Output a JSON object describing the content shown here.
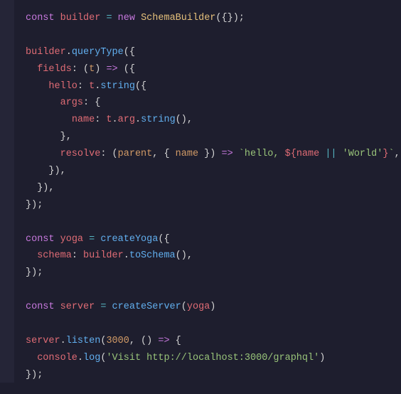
{
  "code": {
    "l1_const": "const",
    "l1_builder": "builder",
    "l1_eq": " = ",
    "l1_new": "new",
    "l1_class": "SchemaBuilder",
    "l1_rest": "({});",
    "l3_builder": "builder",
    "l3_dot": ".",
    "l3_method": "queryType",
    "l3_rest": "({",
    "l4_prop": "fields",
    "l4_colon": ": (",
    "l4_param": "t",
    "l4_rest1": ") ",
    "l4_arrow": "=>",
    "l4_rest2": " ({",
    "l5_prop": "hello",
    "l5_colon": ": ",
    "l5_t": "t",
    "l5_dot": ".",
    "l5_method": "string",
    "l5_rest": "({",
    "l6_prop": "args",
    "l6_rest": ": {",
    "l7_prop": "name",
    "l7_colon": ": ",
    "l7_t": "t",
    "l7_dot1": ".",
    "l7_arg": "arg",
    "l7_dot2": ".",
    "l7_method": "string",
    "l7_rest": "(),",
    "l8": "},",
    "l9_prop": "resolve",
    "l9_colon": ": (",
    "l9_parent": "parent",
    "l9_comma": ", { ",
    "l9_name": "name",
    "l9_close": " }) ",
    "l9_arrow": "=>",
    "l9_space": " ",
    "l9_tick1": "`",
    "l9_str1": "hello, ",
    "l9_interp_open": "${",
    "l9_interp_name": "name",
    "l9_or": " || ",
    "l9_world": "'World'",
    "l9_interp_close": "}",
    "l9_tick2": "`",
    "l9_comma2": ",",
    "l10": "}),",
    "l11": "}),",
    "l12": "});",
    "l14_const": "const",
    "l14_yoga": "yoga",
    "l14_eq": " = ",
    "l14_fn": "createYoga",
    "l14_rest": "({",
    "l15_prop": "schema",
    "l15_colon": ": ",
    "l15_builder": "builder",
    "l15_dot": ".",
    "l15_method": "toSchema",
    "l15_rest": "(),",
    "l16": "});",
    "l18_const": "const",
    "l18_server": "server",
    "l18_eq": " = ",
    "l18_fn": "createServer",
    "l18_open": "(",
    "l18_yoga": "yoga",
    "l18_close": ")",
    "l20_server": "server",
    "l20_dot": ".",
    "l20_method": "listen",
    "l20_open": "(",
    "l20_port": "3000",
    "l20_comma": ", () ",
    "l20_arrow": "=>",
    "l20_rest": " {",
    "l21_console": "console",
    "l21_dot": ".",
    "l21_log": "log",
    "l21_open": "(",
    "l21_str": "'Visit http://localhost:3000/graphql'",
    "l21_close": ")",
    "l22": "});"
  }
}
